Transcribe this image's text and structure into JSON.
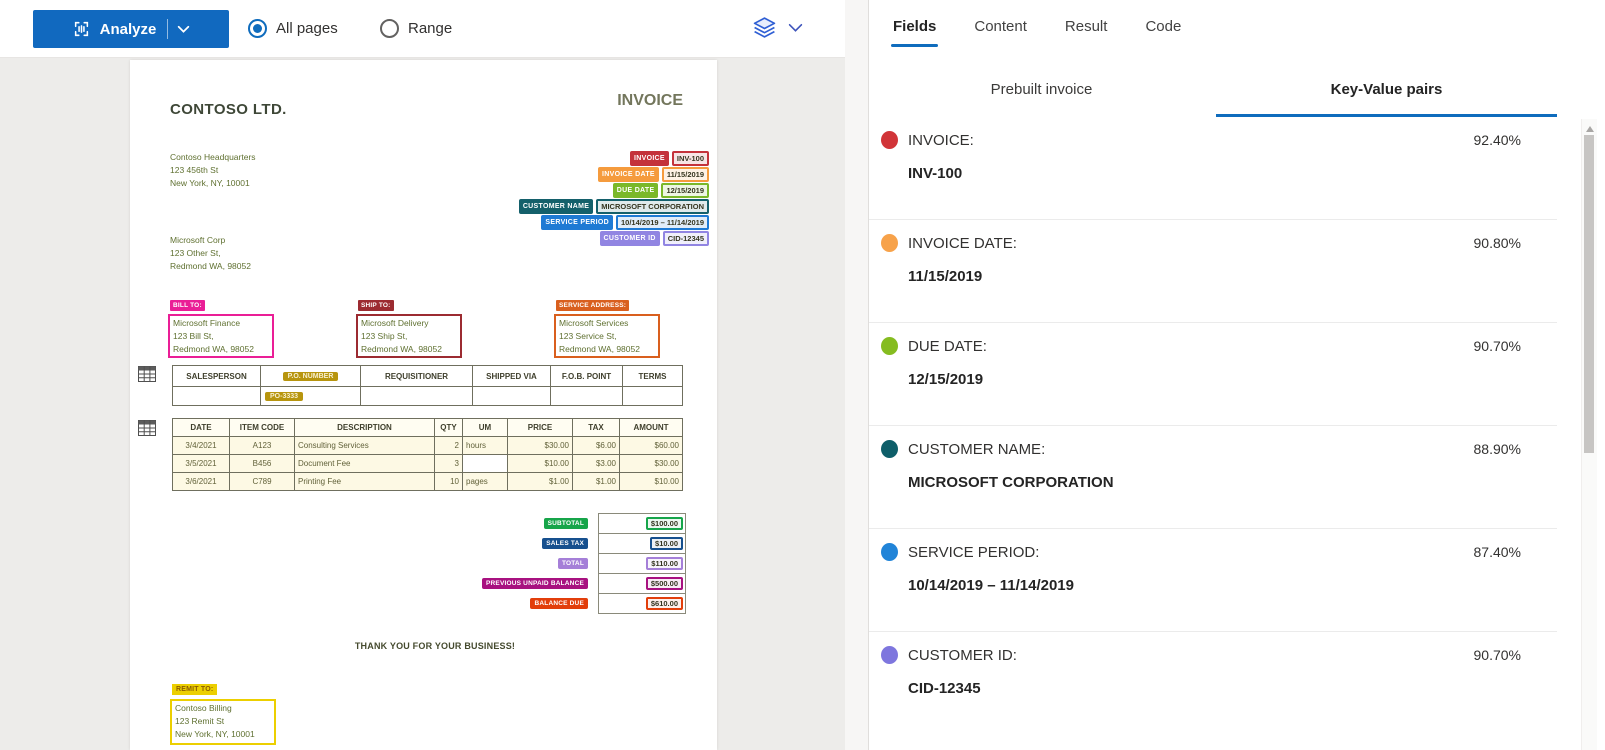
{
  "toolbar": {
    "analyze": "Analyze",
    "all_pages": "All pages",
    "range": "Range"
  },
  "icons": {
    "analyze_button": "document-scan-icon",
    "analyze_dropdown": "chevron-down-icon",
    "layer_selector": "layers-icon",
    "layer_dropdown": "chevron-down-icon",
    "table_marker": "table-grid-icon",
    "scrollbar_top": "scroll-up-arrow-icon"
  },
  "right_panel": {
    "tabs": [
      {
        "label": "Fields",
        "active": true
      },
      {
        "label": "Content",
        "active": false
      },
      {
        "label": "Result",
        "active": false
      },
      {
        "label": "Code",
        "active": false
      }
    ],
    "subtabs": [
      {
        "label": "Prebuilt invoice",
        "active": false
      },
      {
        "label": "Key-Value pairs",
        "active": true
      }
    ],
    "accent_color": "#0f6cbd",
    "pairs": [
      {
        "key": "INVOICE:",
        "value": "INV-100",
        "confidence": "92.40%",
        "color": "#d13438"
      },
      {
        "key": "INVOICE DATE:",
        "value": "11/15/2019",
        "confidence": "90.80%",
        "color": "#f7a24a"
      },
      {
        "key": "DUE DATE:",
        "value": "12/15/2019",
        "confidence": "90.70%",
        "color": "#85bc20"
      },
      {
        "key": "CUSTOMER NAME:",
        "value": "MICROSOFT CORPORATION",
        "confidence": "88.90%",
        "color": "#0e5e69"
      },
      {
        "key": "SERVICE PERIOD:",
        "value": "10/14/2019 – 11/14/2019",
        "confidence": "87.40%",
        "color": "#2184d8"
      },
      {
        "key": "CUSTOMER ID:",
        "value": "CID-12345",
        "confidence": "90.70%",
        "color": "#7e76de"
      }
    ]
  },
  "invoice": {
    "company": "CONTOSO LTD.",
    "title": "INVOICE",
    "header_address": [
      "Contoso Headquarters",
      "123 456th St",
      "New York, NY, 10001"
    ],
    "customer_address": [
      "Microsoft Corp",
      "123 Other St,",
      "Redmond WA, 98052"
    ],
    "annotations": [
      {
        "key": "INVOICE",
        "value": "INV-100",
        "color": "#c4323b"
      },
      {
        "key": "INVOICE DATE",
        "value": "11/15/2019",
        "color": "#f59b3d"
      },
      {
        "key": "DUE DATE",
        "value": "12/15/2019",
        "color": "#7ab829"
      },
      {
        "key": "CUSTOMER NAME",
        "value": "MICROSOFT CORPORATION",
        "color": "#14606b"
      },
      {
        "key": "SERVICE PERIOD",
        "value": "10/14/2019 – 11/14/2019",
        "color": "#1e7ad4"
      },
      {
        "key": "CUSTOMER ID",
        "value": "CID-12345",
        "color": "#9185e2"
      }
    ],
    "address_blocks": [
      {
        "label": "BILL TO:",
        "color": "#ea1e96",
        "lines": [
          "Microsoft Finance",
          "123 Bill St,",
          "Redmond WA, 98052"
        ]
      },
      {
        "label": "SHIP TO:",
        "color": "#9c2b31",
        "lines": [
          "Microsoft Delivery",
          "123 Ship St,",
          "Redmond WA, 98052"
        ]
      },
      {
        "label": "SERVICE ADDRESS:",
        "color": "#d95f1e",
        "lines": [
          "Microsoft Services",
          "123 Service St,",
          "Redmond WA, 98052"
        ]
      }
    ],
    "po_table": {
      "headers": [
        "SALESPERSON",
        "P.O. NUMBER",
        "REQUISITIONER",
        "SHIPPED VIA",
        "F.O.B. POINT",
        "TERMS"
      ],
      "highlighted_header": "P.O. NUMBER",
      "highlight_color": "#b7950e",
      "row_value": "PO-3333",
      "row_value_column": 1
    },
    "items_table": {
      "headers": [
        "DATE",
        "ITEM CODE",
        "DESCRIPTION",
        "QTY",
        "UM",
        "PRICE",
        "TAX",
        "AMOUNT"
      ],
      "rows": [
        [
          "3/4/2021",
          "A123",
          "Consulting Services",
          "2",
          "hours",
          "$30.00",
          "$6.00",
          "$60.00"
        ],
        [
          "3/5/2021",
          "B456",
          "Document Fee",
          "3",
          "",
          "$10.00",
          "$3.00",
          "$30.00"
        ],
        [
          "3/6/2021",
          "C789",
          "Printing Fee",
          "10",
          "pages",
          "$1.00",
          "$1.00",
          "$10.00"
        ]
      ]
    },
    "totals": [
      {
        "label": "SUBTOTAL",
        "value": "$100.00",
        "color": "#17a54a"
      },
      {
        "label": "SALES TAX",
        "value": "$10.00",
        "color": "#17508e"
      },
      {
        "label": "TOTAL",
        "value": "$110.00",
        "color": "#a57fd8"
      },
      {
        "label": "PREVIOUS UNPAID BALANCE",
        "value": "$500.00",
        "color": "#a81180"
      },
      {
        "label": "BALANCE DUE",
        "value": "$610.00",
        "color": "#e23e0b"
      }
    ],
    "thanks": "THANK YOU FOR YOUR BUSINESS!",
    "remit": {
      "label": "REMIT TO:",
      "color": "#eccf00",
      "lines": [
        "Contoso Billing",
        "123 Remit St",
        "New York, NY, 10001"
      ]
    }
  }
}
